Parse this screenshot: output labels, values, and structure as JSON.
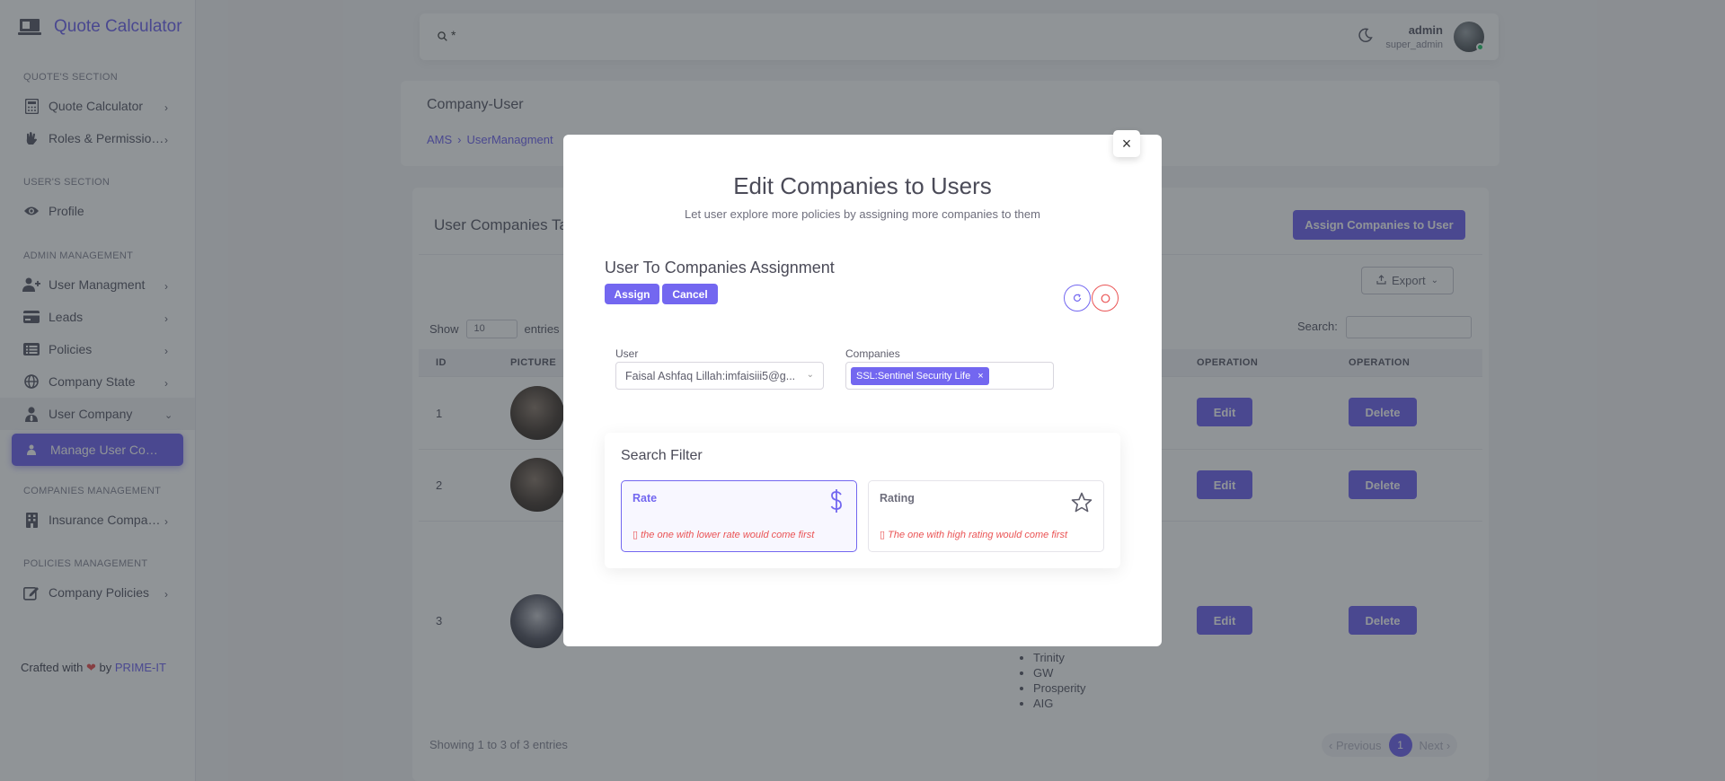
{
  "app": {
    "title": "Quote Calculator"
  },
  "sidebar": {
    "sections": [
      {
        "title": "QUOTE'S SECTION",
        "items": [
          {
            "label": "Quote Calculator",
            "icon": "calculator-icon"
          },
          {
            "label": "Roles & Permissions",
            "icon": "hand-icon"
          }
        ]
      },
      {
        "title": "USER'S SECTION",
        "items": [
          {
            "label": "Profile",
            "icon": "eye-icon"
          }
        ]
      },
      {
        "title": "ADMIN MANAGEMENT",
        "items": [
          {
            "label": "User Managment",
            "icon": "user-plus-icon"
          },
          {
            "label": "Leads",
            "icon": "card-icon"
          },
          {
            "label": "Policies",
            "icon": "list-icon"
          },
          {
            "label": "Company State",
            "icon": "globe-icon"
          },
          {
            "label": "User Company",
            "icon": "user-tie-icon"
          },
          {
            "label": "Manage User Com...",
            "icon": "person-icon"
          }
        ]
      },
      {
        "title": "COMPANIES MANAGEMENT",
        "items": [
          {
            "label": "Insurance Compani...",
            "icon": "building-icon"
          }
        ]
      },
      {
        "title": "POLICIES MANAGEMENT",
        "items": [
          {
            "label": "Company Policies",
            "icon": "edit-icon"
          }
        ]
      }
    ],
    "crafted_prefix": "Crafted with",
    "crafted_by": "by",
    "crafted_brand": "PRIME-IT"
  },
  "topbar": {
    "search_value": "*",
    "user_name": "admin",
    "user_role": "super_admin"
  },
  "page": {
    "title": "Company-User",
    "breadcrumb": [
      "AMS",
      "UserManagment"
    ]
  },
  "table_card": {
    "title": "User Companies Ta",
    "assign_button": "Assign Companies to User",
    "export_button": "Export",
    "show_label": "Show",
    "show_value": "10",
    "entries_label": "entries",
    "search_label": "Search:",
    "columns": [
      "ID",
      "PICTURE",
      "OPERATION",
      "OPERATION"
    ],
    "rows": [
      {
        "id": "1",
        "edit": "Edit",
        "delete": "Delete"
      },
      {
        "id": "2",
        "edit": "Edit",
        "delete": "Delete"
      },
      {
        "id": "3",
        "edit": "Edit",
        "delete": "Delete"
      }
    ],
    "row3_companies": [
      "Trinity",
      "GW",
      "Prosperity",
      "AIG"
    ],
    "footer_info": "Showing 1 to 3 of 3 entries",
    "pager": {
      "previous": "‹ Previous",
      "current": "1",
      "next": "Next ›"
    }
  },
  "modal": {
    "title": "Edit Companies to Users",
    "subtitle": "Let user explore more policies by assigning more companies to them",
    "section_title": "User To Companies Assignment",
    "assign_button": "Assign",
    "cancel_button": "Cancel",
    "user_label": "User",
    "user_value": "Faisal Ashfaq Lillah:imfaisiii5@g...",
    "companies_label": "Companies",
    "selected_company": "SSL:Sentinel Security Life",
    "filter": {
      "title": "Search Filter",
      "options": [
        {
          "label": "Rate",
          "description": "the one with lower rate would come first",
          "icon": "dollar-icon",
          "selected": true
        },
        {
          "label": "Rating",
          "description": "The one with high rating would come first",
          "icon": "star-icon",
          "selected": false
        }
      ]
    }
  },
  "colors": {
    "accent": "#7367f0",
    "danger": "#ea5455"
  }
}
